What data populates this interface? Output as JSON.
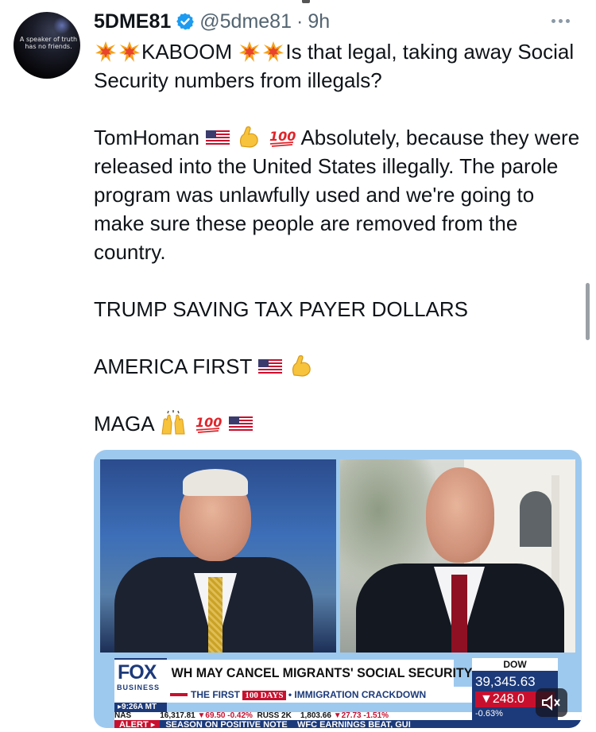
{
  "tweet": {
    "author_name": "5DME81",
    "handle": "@5dme81",
    "separator": "·",
    "time": "9h",
    "avatar_text": "A speaker of truth has no friends.",
    "lines": {
      "l1": "KABOOM",
      "l1b": "Is that legal, taking away Social Security numbers from illegals?",
      "l2a": "TomHoman",
      "l2b": "Absolutely, because they were released into the United States illegally. The parole program was unlawfully used and we're going to make sure these people are removed from the country.",
      "l3": "TRUMP SAVING TAX PAYER DOLLARS",
      "l4": "AMERICA FIRST",
      "l5": "MAGA"
    },
    "icons": [
      "verified-badge-icon",
      "more-options-icon",
      "collision-emoji-icon",
      "us-flag-emoji-icon",
      "flexed-biceps-emoji-icon",
      "hundred-points-emoji-icon",
      "raising-hands-emoji-icon",
      "mute-icon"
    ]
  },
  "video": {
    "network_logo": "FOX",
    "network_sub": "BUSINESS",
    "headline": "WH MAY CANCEL MIGRANTS' SOCIAL SECURITY NUMBERS",
    "subline_a": "THE FIRST",
    "subline_badge": "100 DAYS",
    "subline_b": "• IMMIGRATION CRACKDOWN",
    "clock": "▸9:26A MT",
    "ticker": {
      "nas_label": "NAS",
      "nas_value": "16,317.81",
      "nas_change": "▼69.50",
      "nas_pct": "-0.42%",
      "russ_label": "RUSS 2K",
      "russ_value": "1,803.66",
      "russ_change": "▼27.73",
      "russ_pct": "-1.51%"
    },
    "alert_tag": "ALERT ▸",
    "alert_text": "SEASON ON POSITIVE NOTE",
    "alert_text2": "WFC EARNINGS BEAT, GUI",
    "dow_label": "DOW",
    "dow_value": "39,345.63",
    "dow_change": "▼248.0",
    "dow_pct": "-0.63%"
  },
  "colors": {
    "text": "#0f1419",
    "muted": "#536471",
    "verified": "#1d9bf0",
    "fox_navy": "#1c3a7a",
    "fox_red": "#c8102e"
  }
}
